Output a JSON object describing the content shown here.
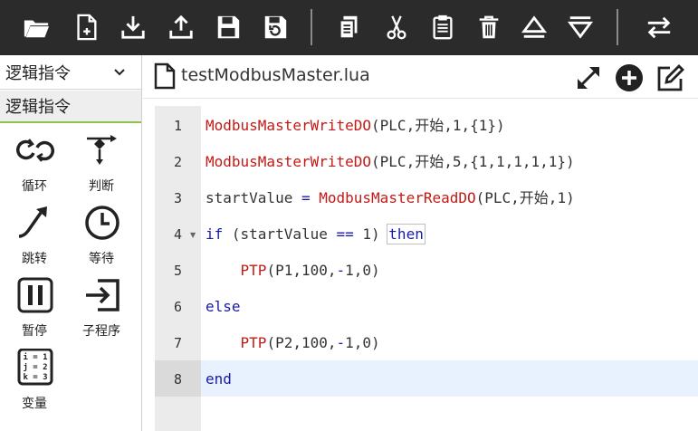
{
  "toolbar": {
    "buttons": [
      {
        "name": "open-folder-icon"
      },
      {
        "name": "new-file-icon"
      },
      {
        "name": "download-icon"
      },
      {
        "name": "upload-icon"
      },
      {
        "name": "save-icon"
      },
      {
        "name": "save-as-icon"
      },
      {
        "name": "copy-icon"
      },
      {
        "name": "cut-icon"
      },
      {
        "name": "paste-icon"
      },
      {
        "name": "delete-icon"
      },
      {
        "name": "move-up-icon"
      },
      {
        "name": "move-down-icon"
      },
      {
        "name": "swap-icon"
      }
    ]
  },
  "sidebar": {
    "category_select": "逻辑指令",
    "active_category": "逻辑指令",
    "tools": [
      {
        "label": "循环",
        "icon": "loop-icon"
      },
      {
        "label": "判断",
        "icon": "branch-icon"
      },
      {
        "label": "跳转",
        "icon": "jump-icon"
      },
      {
        "label": "等待",
        "icon": "clock-icon"
      },
      {
        "label": "暂停",
        "icon": "pause-icon"
      },
      {
        "label": "子程序",
        "icon": "subprogram-icon"
      },
      {
        "label": "变量",
        "icon": "variable-icon"
      }
    ],
    "variable_icon_text": [
      "i = 1",
      "j = 2",
      "k = 3"
    ]
  },
  "editor": {
    "file_name": "testModbusMaster.lua",
    "header_buttons": [
      "expand-icon",
      "add-circle-icon",
      "edit-icon"
    ],
    "active_line": 8,
    "lines": [
      {
        "num": "1",
        "parts": [
          [
            "fn",
            "ModbusMasterWriteDO"
          ],
          [
            "id",
            "(PLC,开始,1,{1})"
          ]
        ]
      },
      {
        "num": "2",
        "parts": [
          [
            "fn",
            "ModbusMasterWriteDO"
          ],
          [
            "id",
            "(PLC,开始,5,{1,1,1,1,1})"
          ]
        ]
      },
      {
        "num": "3",
        "parts": [
          [
            "id",
            "startValue "
          ],
          [
            "op",
            "="
          ],
          [
            "id",
            " "
          ],
          [
            "fn",
            "ModbusMasterReadDO"
          ],
          [
            "id",
            "(PLC,开始,1)"
          ]
        ]
      },
      {
        "num": "4",
        "fold": true,
        "parts": [
          [
            "kw",
            "if"
          ],
          [
            "id",
            " (startValue "
          ],
          [
            "op",
            "=="
          ],
          [
            "id",
            " 1) "
          ],
          [
            "kwbox",
            "then"
          ]
        ]
      },
      {
        "num": "5",
        "parts": [
          [
            "id",
            "    "
          ],
          [
            "fn",
            "PTP"
          ],
          [
            "id",
            "(P1,100,"
          ],
          [
            "op",
            "-"
          ],
          [
            "id",
            "1,0)"
          ]
        ]
      },
      {
        "num": "6",
        "parts": [
          [
            "kw",
            "else"
          ]
        ]
      },
      {
        "num": "7",
        "parts": [
          [
            "id",
            "    "
          ],
          [
            "fn",
            "PTP"
          ],
          [
            "id",
            "(P2,100,"
          ],
          [
            "op",
            "-"
          ],
          [
            "id",
            "1,0)"
          ]
        ]
      },
      {
        "num": "8",
        "parts": [
          [
            "kw",
            "end"
          ]
        ]
      }
    ]
  }
}
